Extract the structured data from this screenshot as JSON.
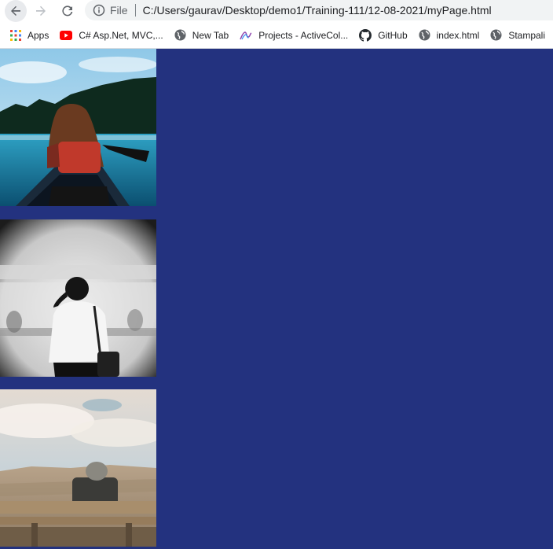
{
  "browser": {
    "scheme_label": "File",
    "url": "C:/Users/gaurav/Desktop/demo1/Training-111/12-08-2021/myPage.html"
  },
  "bookmarks": [
    {
      "label": "Apps",
      "icon": "apps-grid-icon"
    },
    {
      "label": "C# Asp.Net, MVC,...",
      "icon": "youtube-icon"
    },
    {
      "label": "New Tab",
      "icon": "globe-icon"
    },
    {
      "label": "Projects - ActiveCol...",
      "icon": "activecollab-icon"
    },
    {
      "label": "GitHub",
      "icon": "github-icon"
    },
    {
      "label": "index.html",
      "icon": "globe-icon"
    },
    {
      "label": "Stampali",
      "icon": "globe-icon"
    }
  ],
  "page": {
    "background_color": "#23327f",
    "images": [
      {
        "subject": "woman in canoe on lake"
      },
      {
        "subject": "woman waiting beside train"
      },
      {
        "subject": "person sitting on bench facing sky"
      }
    ]
  }
}
